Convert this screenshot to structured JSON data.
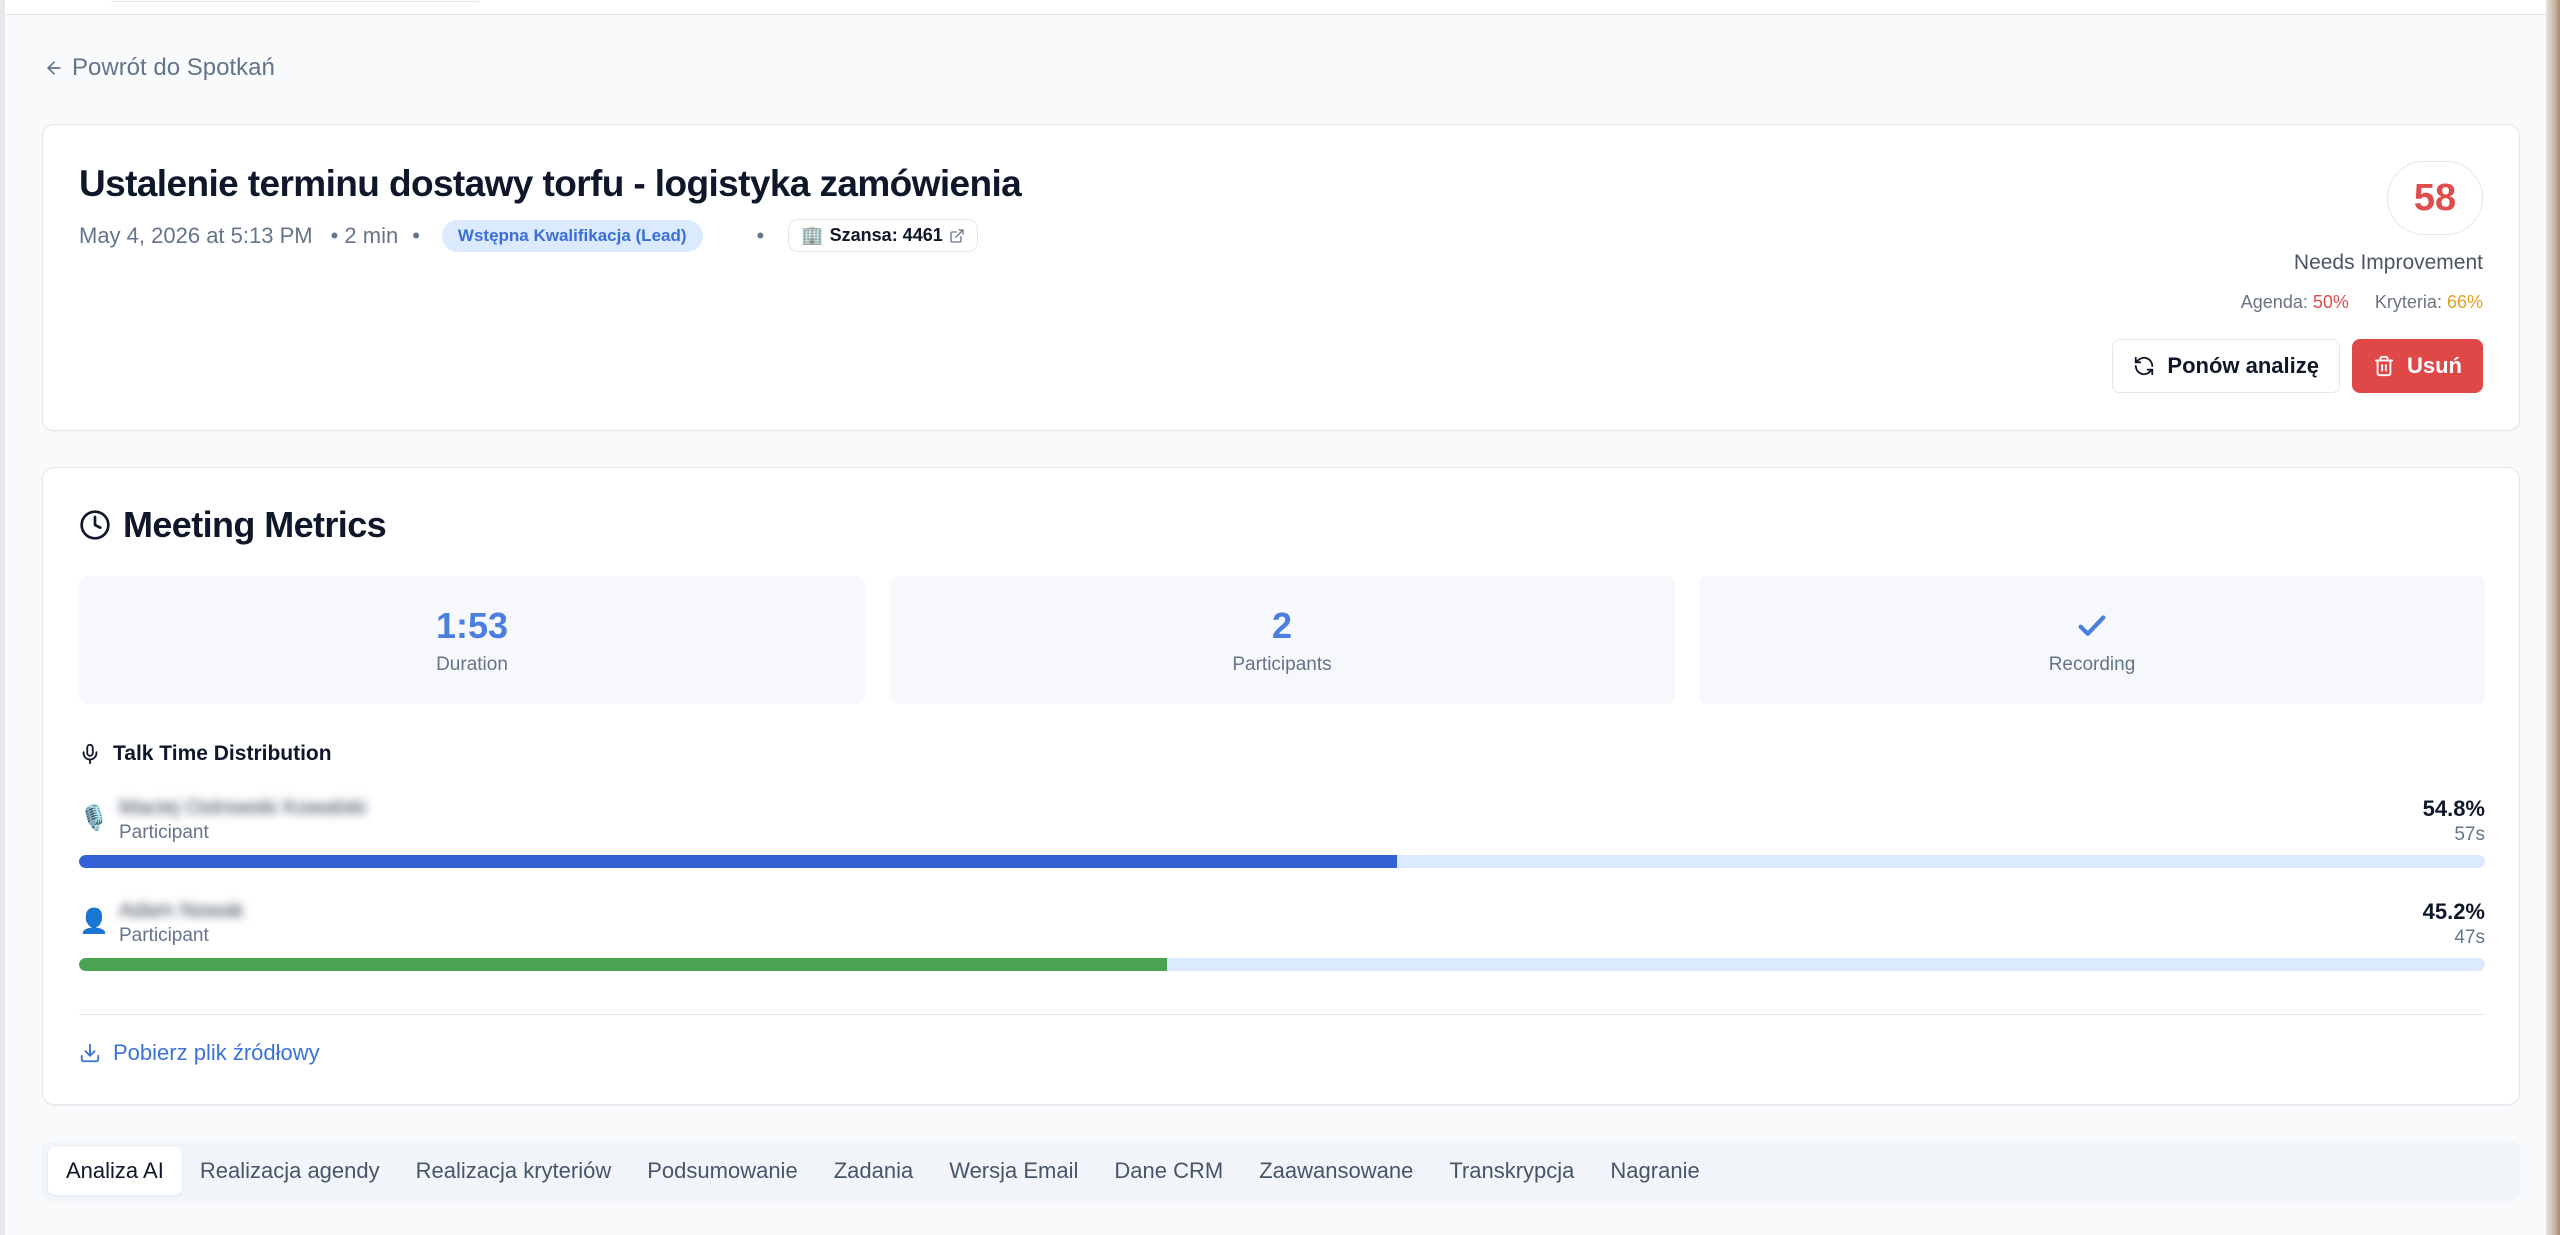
{
  "nav": {
    "back_label": "Powrót do Spotkań"
  },
  "meeting": {
    "title": "Ustalenie terminu dostawy torfu - logistyka zamówienia",
    "date": "May 4, 2026 at 5:13 PM",
    "duration": "• 2 min",
    "sep": "•",
    "stage": "Wstępna Kwalifikacja (Lead)",
    "opportunity_label": "Szansa: 4461",
    "opportunity_icon": "🏢"
  },
  "score": {
    "value": "58",
    "label": "Needs Improvement",
    "agenda_label": "Agenda:",
    "agenda_value": "50%",
    "criteria_label": "Kryteria:",
    "criteria_value": "66%",
    "colors": {
      "bad": "#e04c4c",
      "warn": "#e0a020"
    }
  },
  "actions": {
    "reanalyze_label": "Ponów analizę",
    "delete_label": "Usuń"
  },
  "metrics": {
    "title": "Meeting Metrics",
    "tiles": [
      {
        "value": "1:53",
        "label": "Duration"
      },
      {
        "value": "2",
        "label": "Participants"
      },
      {
        "value": "",
        "label": "Recording",
        "icon": "check-icon"
      }
    ],
    "talk_title": "Talk Time Distribution",
    "speakers": [
      {
        "name": "Maciej Ostrowski Kowalski",
        "role": "Participant",
        "percent": "54.8%",
        "share": 54.8,
        "seconds": "57s",
        "avatar": "🎙️",
        "color": "#3462d6"
      },
      {
        "name": "Adam Nowak",
        "role": "Participant",
        "percent": "45.2%",
        "share": 45.2,
        "seconds": "47s",
        "avatar": "👤",
        "color": "#4ba352"
      }
    ],
    "download_label": "Pobierz plik źródłowy"
  },
  "tabs": [
    {
      "label": "Analiza AI",
      "active": true
    },
    {
      "label": "Realizacja agendy"
    },
    {
      "label": "Realizacja kryteriów"
    },
    {
      "label": "Podsumowanie"
    },
    {
      "label": "Zadania"
    },
    {
      "label": "Wersja Email"
    },
    {
      "label": "Dane CRM"
    },
    {
      "label": "Zaawansowane"
    },
    {
      "label": "Transkrypcja"
    },
    {
      "label": "Nagranie"
    }
  ]
}
